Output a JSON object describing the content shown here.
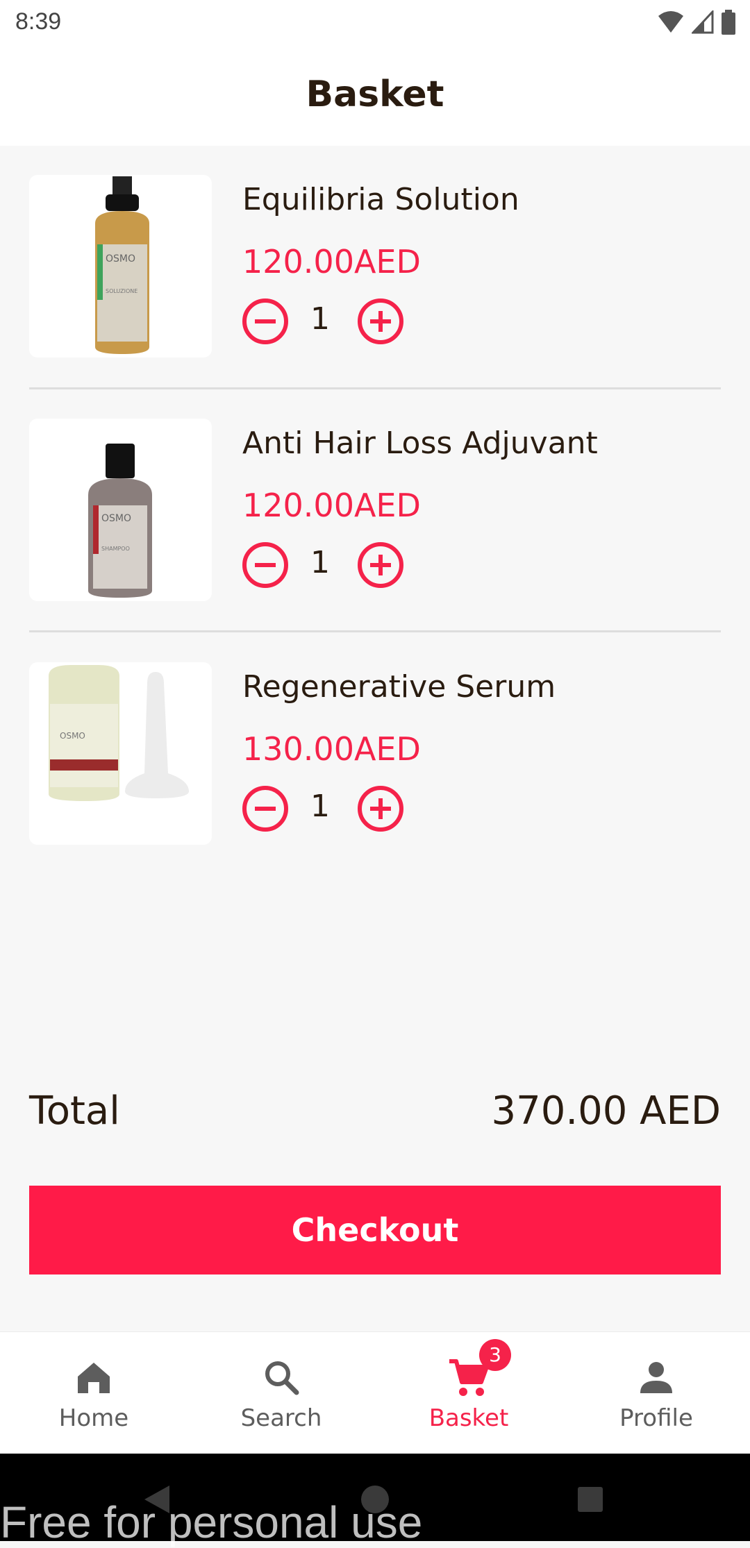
{
  "status_bar": {
    "time": "8:39"
  },
  "app_bar": {
    "title": "Basket"
  },
  "items": [
    {
      "name": "Equilibria Solution",
      "price": "120.00AED",
      "qty": "1"
    },
    {
      "name": "Anti Hair Loss Adjuvant",
      "price": "120.00AED",
      "qty": "1"
    },
    {
      "name": "Regenerative Serum",
      "price": "130.00AED",
      "qty": "1"
    }
  ],
  "total": {
    "label": "Total",
    "value": "370.00 AED"
  },
  "checkout": {
    "label": "Checkout"
  },
  "nav": {
    "items": [
      {
        "label": "Home",
        "icon": "home-icon"
      },
      {
        "label": "Search",
        "icon": "search-icon"
      },
      {
        "label": "Basket",
        "icon": "cart-icon",
        "badge": "3"
      },
      {
        "label": "Profile",
        "icon": "person-icon"
      }
    ],
    "active": "Basket"
  },
  "watermark": "Free for personal use",
  "colors": {
    "accent": "#f5224a",
    "checkout": "#ff1b48",
    "text": "#2a1c10"
  }
}
